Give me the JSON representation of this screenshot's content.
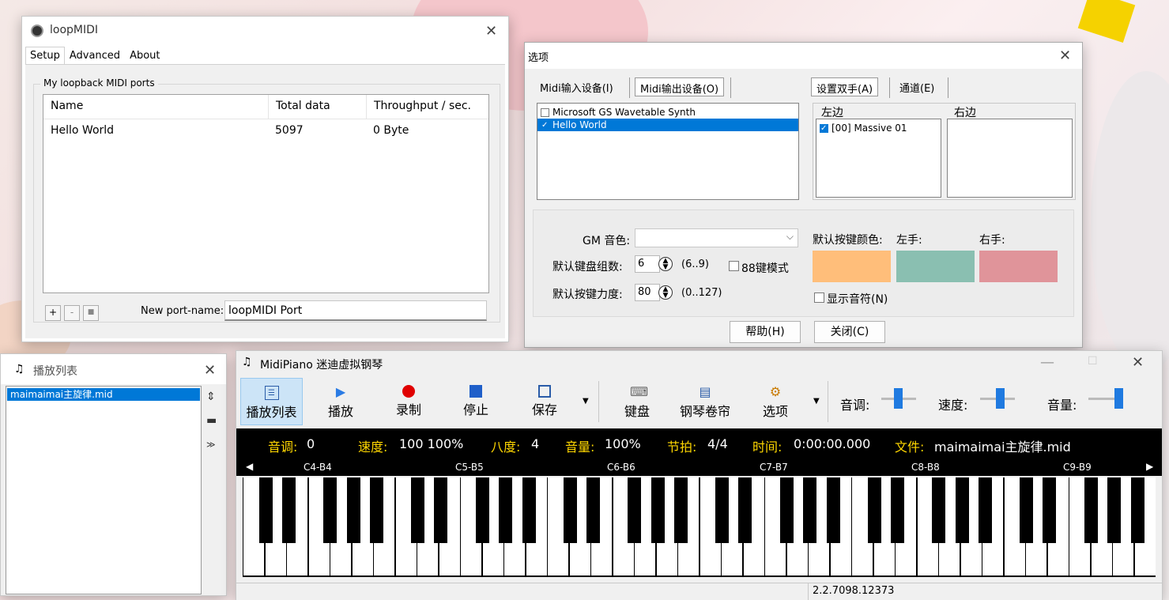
{
  "loopmidi": {
    "title": "loopMIDI",
    "tabs": [
      "Setup",
      "Advanced",
      "About"
    ],
    "group_label": "My loopback MIDI ports",
    "columns": [
      "Name",
      "Total data",
      "Throughput / sec."
    ],
    "rows": [
      [
        "Hello World",
        "5097",
        "0 Byte"
      ]
    ],
    "buttons": [
      "+",
      "-",
      "■"
    ],
    "new_port_label": "New port-name:",
    "new_port_value": "loopMIDI Port"
  },
  "options": {
    "title": "选项",
    "tabs_left": [
      "Midi输入设备(I)",
      "Midi输出设备(O)"
    ],
    "tabs_right": [
      "设置双手(A)",
      "通道(E)"
    ],
    "devices": [
      {
        "label": "Microsoft GS Wavetable Synth",
        "checked": false
      },
      {
        "label": "Hello World",
        "checked": true
      }
    ],
    "left_label": "左边",
    "right_label": "右边",
    "left_items": [
      {
        "label": "[00] Massive 01",
        "checked": true
      }
    ],
    "gm_label": "GM 音色:",
    "kb_group_label": "默认键盘组数:",
    "kb_group_value": "6",
    "kb_group_range": "(6..9)",
    "mode88_label": "88键模式",
    "velocity_label": "默认按键力度:",
    "velocity_value": "80",
    "velocity_range": "(0..127)",
    "default_color_label": "默认按键颜色:",
    "left_hand_label": "左手:",
    "right_hand_label": "右手:",
    "colors": {
      "default": "#ffbe7a",
      "left": "#8abfb1",
      "right": "#e0949a"
    },
    "show_note_label": "显示音符(N)",
    "help_button": "帮助(H)",
    "close_button": "关闭(C)"
  },
  "playlist": {
    "title": "播放列表",
    "items": [
      "maimaimai主旋律.mid"
    ]
  },
  "midipiano": {
    "title": "MidiPiano 迷迪虚拟钢琴",
    "toolbar": [
      "播放列表",
      "播放",
      "录制",
      "停止",
      "保存",
      "键盘",
      "钢琴卷帘",
      "选项"
    ],
    "pitch_label": "音调:",
    "speed_label": "速度:",
    "volume_label": "音量:",
    "status": {
      "pitch_k": "音调:",
      "pitch_v": "0",
      "speed_k": "速度:",
      "speed_v": "100 100%",
      "octave_k": "八度:",
      "octave_v": "4",
      "volume_k": "音量:",
      "volume_v": "100%",
      "beat_k": "节拍:",
      "beat_v": "4/4",
      "time_k": "时间:",
      "time_v": "0:00:00.000",
      "file_k": "文件:",
      "file_v": "maimaimai主旋律.mid"
    },
    "octaves": [
      "C4-B4",
      "C5-B5",
      "C6-B6",
      "C7-B7",
      "C8-B8",
      "C9-B9"
    ],
    "version": "2.2.7098.12373"
  }
}
